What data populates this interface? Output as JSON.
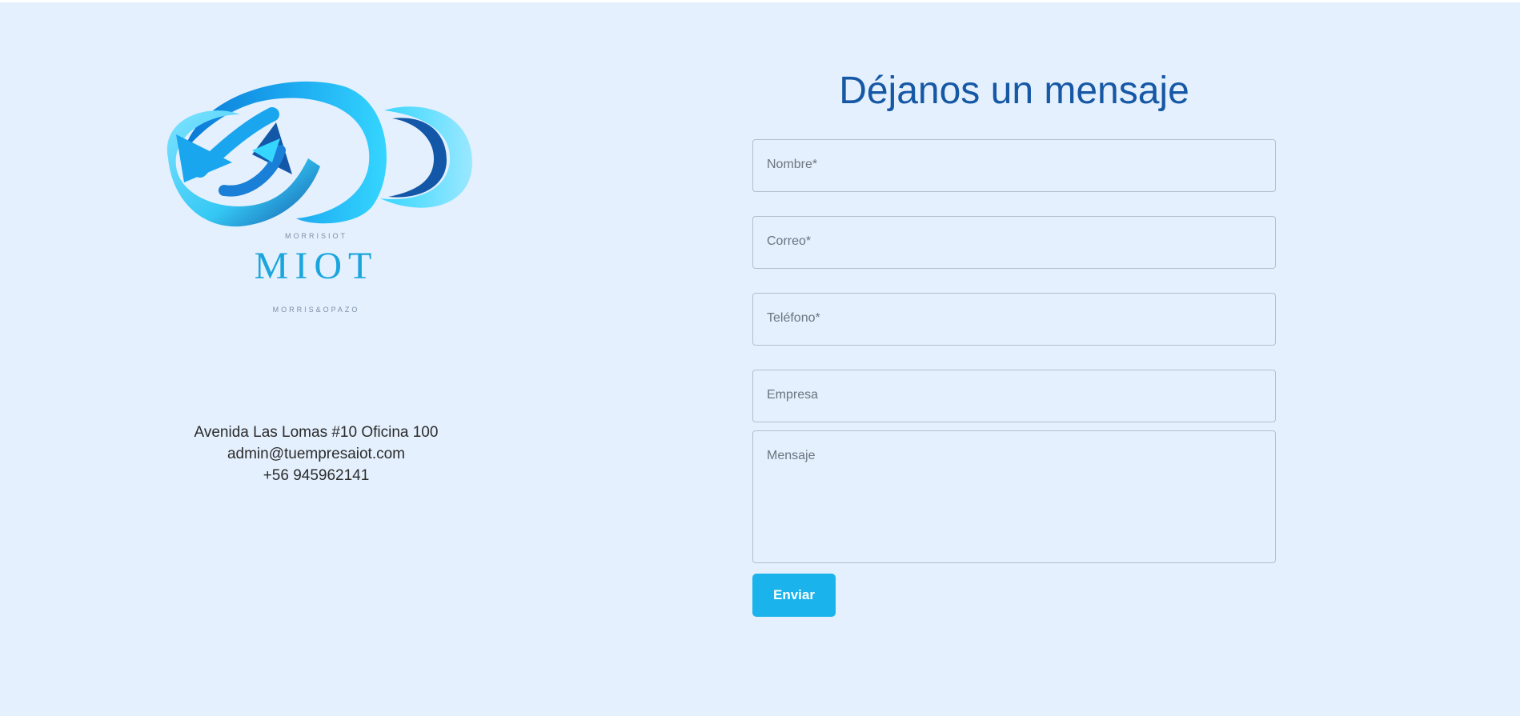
{
  "brand": {
    "top_small": "MORRISIOT",
    "name": "MIOT",
    "bottom_small": "MORRIS&OPAZO",
    "colors": {
      "light_blue": "#35d6ff",
      "mid_blue": "#1aa6dd",
      "dark_blue": "#1358a8"
    }
  },
  "contact": {
    "address": "Avenida Las Lomas #10 Oficina 100",
    "email": "admin@tuempresaiot.com",
    "phone": "+56 945962141"
  },
  "form": {
    "title": "Déjanos un mensaje",
    "fields": {
      "nombre": "Nombre*",
      "correo": "Correo*",
      "telefono": "Teléfono*",
      "empresa": "Empresa",
      "mensaje": "Mensaje"
    },
    "submit_label": "Enviar"
  },
  "theme": {
    "background": "#e4f0fd",
    "title_color": "#1658a5",
    "button_color": "#1ab3ec"
  }
}
